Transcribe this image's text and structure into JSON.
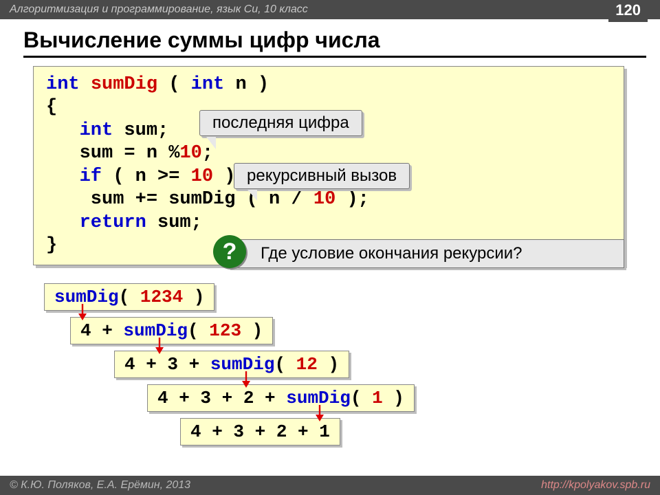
{
  "header": {
    "course": "Алгоритмизация и программирование, язык Си, 10 класс",
    "page_number": "120"
  },
  "footer": {
    "copyright": "© К.Ю. Поляков, Е.А. Ерёмин, 2013",
    "url": "http://kpolyakov.spb.ru"
  },
  "title": "Вычисление суммы цифр числа",
  "code": {
    "l1a": "int",
    "l1b": " ",
    "l1c": "sumDig",
    "l1d": " ( ",
    "l1e": "int",
    "l1f": " n )",
    "l2": "{",
    "l3a": "   ",
    "l3b": "int",
    "l3c": " sum;",
    "l4a": "   sum = n %",
    "l4b": "10",
    "l4c": ";",
    "l5a": "   ",
    "l5b": "if",
    "l5c": " ( n >= ",
    "l5d": "10",
    "l5e": " )",
    "l6a": "    sum += sumDig ( n / ",
    "l6b": "10",
    "l6c": " );",
    "l7a": "   ",
    "l7b": "return",
    "l7c": " sum;",
    "l8": "}"
  },
  "callouts": {
    "last_digit": "последняя цифра",
    "rec_call": "рекурсивный вызов",
    "question_mark": "?",
    "question": "Где условие окончания рекурсии?"
  },
  "steps": {
    "s1a": "sumDig",
    "s1b": "( ",
    "s1c": "1234",
    "s1d": " )",
    "s2a": "4 + ",
    "s2b": "sumDig",
    "s2c": "( ",
    "s2d": "123",
    "s2e": " )",
    "s3a": "4 + 3 + ",
    "s3b": "sumDig",
    "s3c": "( ",
    "s3d": "12",
    "s3e": " )",
    "s4a": "4 + 3 + 2 + ",
    "s4b": "sumDig",
    "s4c": "( ",
    "s4d": "1",
    "s4e": " )",
    "s5": "4 + 3 + 2 + 1"
  }
}
